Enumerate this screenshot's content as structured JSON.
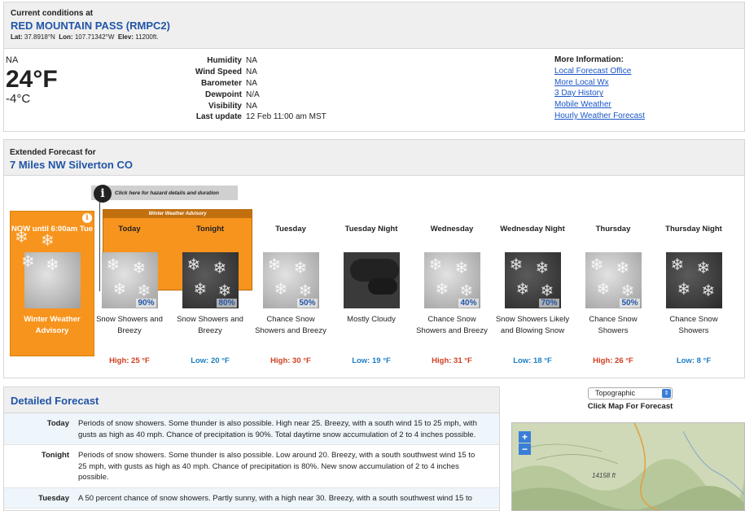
{
  "current": {
    "heading": "Current conditions at",
    "station": "RED MOUNTAIN PASS (RMPC2)",
    "lat_label": "Lat:",
    "lat": "37.8918°N",
    "lon_label": "Lon:",
    "lon": "107.71342°W",
    "elev_label": "Elev:",
    "elev": "11200ft.",
    "condition": "NA",
    "temp_f": "24°F",
    "temp_c": "-4°C",
    "details": [
      {
        "key": "Humidity",
        "value": "NA"
      },
      {
        "key": "Wind Speed",
        "value": "NA"
      },
      {
        "key": "Barometer",
        "value": "NA"
      },
      {
        "key": "Dewpoint",
        "value": "N/A"
      },
      {
        "key": "Visibility",
        "value": "NA"
      },
      {
        "key": "Last update",
        "value": "12 Feb 11:00 am MST"
      }
    ],
    "more_heading": "More Information:",
    "more_links": [
      "Local Forecast Office",
      "More Local Wx",
      "3 Day History",
      "Mobile Weather",
      "Hourly Weather Forecast"
    ]
  },
  "extended": {
    "heading": "Extended Forecast for",
    "location": "7 Miles NW Silverton CO",
    "hazard_button": "Click here for hazard details and duration",
    "advisory_band": "Winter Weather Advisory",
    "now": {
      "name": "NOW until 6:00am Tue",
      "desc": "Winter Weather Advisory"
    },
    "periods": [
      {
        "name": "Today",
        "tod": "day",
        "pct": "90%",
        "desc": "Snow Showers and Breezy",
        "temp": "High: 25 °F",
        "kind": "hi"
      },
      {
        "name": "Tonight",
        "tod": "night",
        "pct": "80%",
        "desc": "Snow Showers and Breezy",
        "temp": "Low: 20 °F",
        "kind": "lo"
      },
      {
        "name": "Tuesday",
        "tod": "day",
        "pct": "50%",
        "desc": "Chance Snow Showers and Breezy",
        "temp": "High: 30 °F",
        "kind": "hi"
      },
      {
        "name": "Tuesday Night",
        "tod": "cloudy",
        "pct": "",
        "desc": "Mostly Cloudy",
        "temp": "Low: 19 °F",
        "kind": "lo"
      },
      {
        "name": "Wednesday",
        "tod": "day",
        "pct": "40%",
        "desc": "Chance Snow Showers and Breezy",
        "temp": "High: 31 °F",
        "kind": "hi"
      },
      {
        "name": "Wednesday Night",
        "tod": "night",
        "pct": "70%",
        "desc": "Snow Showers Likely and Blowing Snow",
        "temp": "Low: 18 °F",
        "kind": "lo"
      },
      {
        "name": "Thursday",
        "tod": "day",
        "pct": "50%",
        "desc": "Chance Snow Showers",
        "temp": "High: 26 °F",
        "kind": "hi"
      },
      {
        "name": "Thursday Night",
        "tod": "night",
        "pct": "",
        "desc": "Chance Snow Showers",
        "temp": "Low: 8 °F",
        "kind": "lo"
      }
    ]
  },
  "detailed": {
    "heading": "Detailed Forecast",
    "rows": [
      {
        "key": "Today",
        "text": "Periods of snow showers. Some thunder is also possible. High near 25. Breezy, with a south wind 15 to 25 mph, with gusts as high as 40 mph. Chance of precipitation is 90%. Total daytime snow accumulation of 2 to 4 inches possible."
      },
      {
        "key": "Tonight",
        "text": "Periods of snow showers. Some thunder is also possible. Low around 20. Breezy, with a south southwest wind 15 to 25 mph, with gusts as high as 40 mph. Chance of precipitation is 80%. New snow accumulation of 2 to 4 inches possible."
      },
      {
        "key": "Tuesday",
        "text": "A 50 percent chance of snow showers. Partly sunny, with a high near 30. Breezy, with a south southwest wind 15 to"
      }
    ]
  },
  "map": {
    "select_value": "Topographic",
    "click_text": "Click Map For Forecast",
    "zoom_in": "+",
    "zoom_out": "−",
    "elevation_label": "14158 ft"
  },
  "colors": {
    "advisory": "#f7941d",
    "link": "#1a56c8",
    "high": "#d13d20",
    "low": "#1a7ec4"
  }
}
